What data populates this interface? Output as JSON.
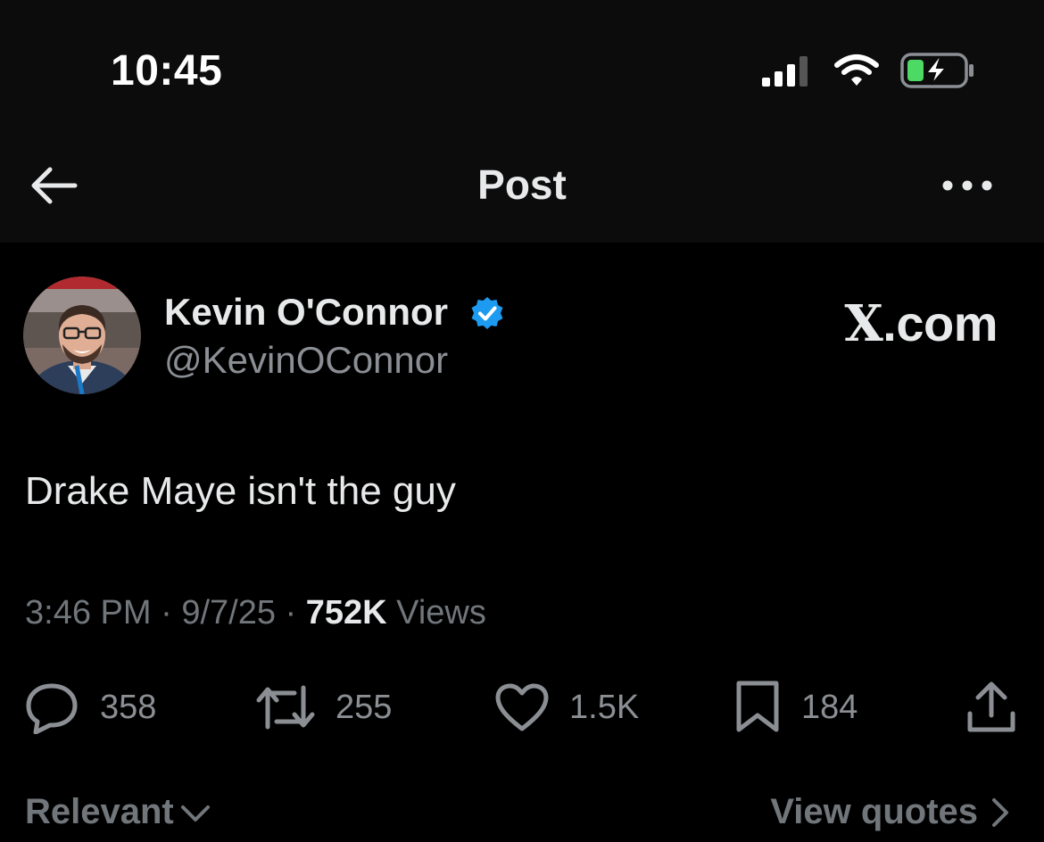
{
  "status_bar": {
    "time": "10:45",
    "icons": [
      "cellular-signal-icon",
      "wifi-icon",
      "battery-charging-icon"
    ]
  },
  "nav": {
    "back_icon": "back-arrow-icon",
    "title": "Post",
    "more_icon": "more-horizontal-icon"
  },
  "post": {
    "author": {
      "name": "Kevin O'Connor",
      "handle": "@KevinOConnor",
      "verified_icon": "verified-badge-icon"
    },
    "watermark_prefix": "X",
    "watermark_suffix": ".com",
    "text": "Drake Maye isn't the guy",
    "time": "3:46 PM",
    "date": "9/7/25",
    "views_count": "752K",
    "views_label": "Views",
    "sep": "·"
  },
  "actions": {
    "replies": "358",
    "reposts": "255",
    "likes": "1.5K",
    "bookmarks": "184"
  },
  "footer": {
    "sort_label": "Relevant",
    "quotes_label": "View quotes"
  },
  "colors": {
    "background": "#000000",
    "topbar": "#0c0c0c",
    "text_primary": "#e7e9ea",
    "text_secondary": "#71767b",
    "verified_blue": "#1d9bf0",
    "battery_green": "#4cd964"
  }
}
